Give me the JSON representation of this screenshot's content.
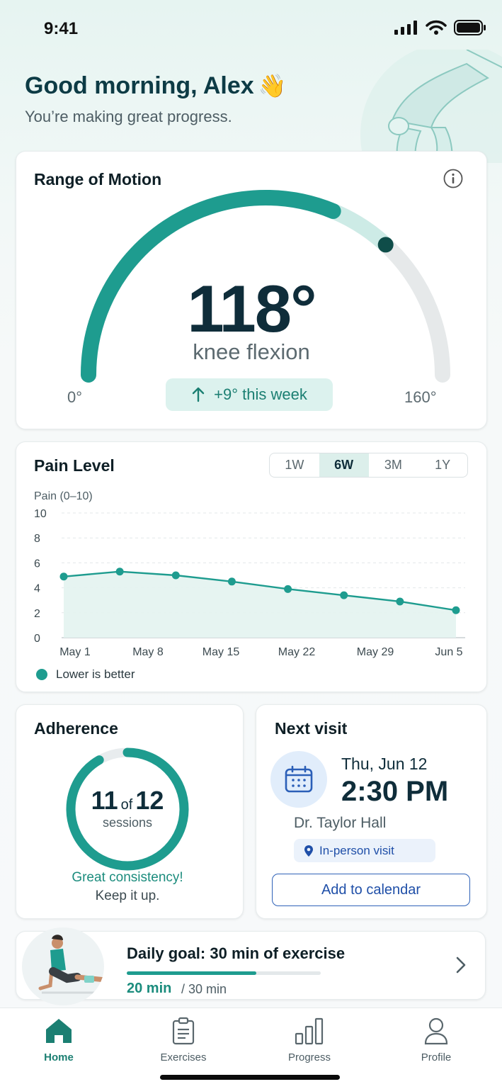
{
  "status": {
    "time": "9:41",
    "icons": [
      "signal-icon",
      "wifi-icon",
      "battery-icon"
    ]
  },
  "header": {
    "greeting": "Good morning, Alex",
    "wave": "👋",
    "subtitle": "You’re making great progress."
  },
  "rom": {
    "title": "Range of Motion",
    "value": "118°",
    "label": "knee flexion",
    "min_label": "0°",
    "max_label": "160°",
    "delta": "+9° this week",
    "current_deg": 118,
    "max_deg": 160
  },
  "pain": {
    "title": "Pain Level",
    "ranges": [
      "1W",
      "6W",
      "3M",
      "1Y"
    ],
    "selected_range": "6W",
    "y_axis_label": "Pain (0–10)",
    "legend": "Lower is better"
  },
  "chart_data": {
    "type": "area",
    "ylabel": "Pain (0–10)",
    "ylim": [
      0,
      10
    ],
    "yticks": [
      0,
      2,
      4,
      6,
      8,
      10
    ],
    "xticks": [
      "May 1",
      "May 8",
      "May 15",
      "May 22",
      "May 29",
      "Jun 5"
    ],
    "x": [
      "May 1",
      "May 5",
      "May 10",
      "May 15",
      "May 21",
      "May 27",
      "Jun 2",
      "Jun 7"
    ],
    "values": [
      4.9,
      5.3,
      5.0,
      4.5,
      3.9,
      3.4,
      2.9,
      2.2
    ],
    "grid": true,
    "legend_position": "bottom-left"
  },
  "adherence": {
    "title": "Adherence",
    "completed": "11",
    "of_text": "of",
    "total": "12",
    "sessions_label": "sessions",
    "message": "Great consistency!",
    "sub_message": "Keep it up.",
    "fraction": 0.9167
  },
  "visit": {
    "title": "Next visit",
    "date": "Thu, Jun 12",
    "time": "2:30 PM",
    "doctor": "Dr. Taylor Hall",
    "type": "In-person visit",
    "button": "Add to calendar"
  },
  "goal": {
    "title": "Daily goal: 30 min of exercise",
    "current": "20 min",
    "total": "/ 30 min",
    "progress": 0.6667
  },
  "nav": [
    {
      "label": "Home",
      "icon": "home-icon",
      "active": true
    },
    {
      "label": "Exercises",
      "icon": "clipboard-icon",
      "active": false
    },
    {
      "label": "Progress",
      "icon": "bar-chart-icon",
      "active": false
    },
    {
      "label": "Profile",
      "icon": "person-icon",
      "active": false
    }
  ],
  "colors": {
    "accent": "#1e9c8f",
    "dark": "#0f2d3a",
    "blue": "#1f4fa8"
  }
}
